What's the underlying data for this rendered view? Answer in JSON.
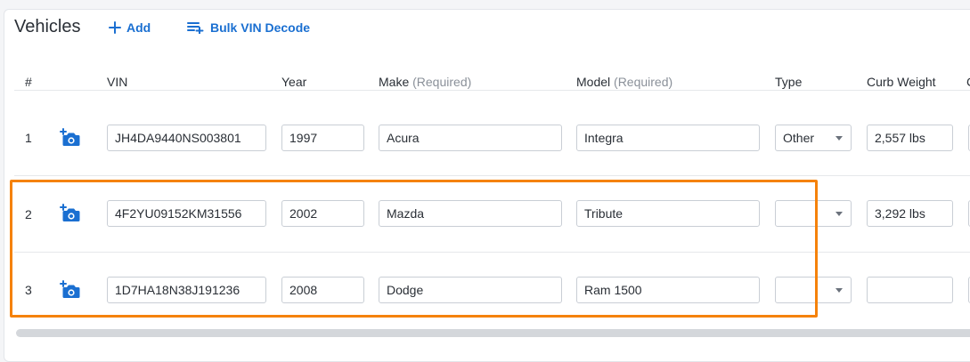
{
  "toolbar": {
    "title": "Vehicles",
    "add_label": "Add",
    "bulk_label": "Bulk VIN Decode"
  },
  "columns": {
    "num": "#",
    "vin": "VIN",
    "year": "Year",
    "make": "Make",
    "make_req": "(Required)",
    "model": "Model",
    "model_req": "(Required)",
    "type": "Type",
    "curb_weight": "Curb Weight",
    "next": "C"
  },
  "rows": [
    {
      "num": "1",
      "vin": "JH4DA9440NS003801",
      "year": "1997",
      "make": "Acura",
      "model": "Integra",
      "type": "Other",
      "curb_weight": "2,557 lbs"
    },
    {
      "num": "2",
      "vin": "4F2YU09152KM31556",
      "year": "2002",
      "make": "Mazda",
      "model": "Tribute",
      "type": "",
      "curb_weight": "3,292 lbs"
    },
    {
      "num": "3",
      "vin": "1D7HA18N38J191236",
      "year": "2008",
      "make": "Dodge",
      "model": "Ram 1500",
      "type": "",
      "curb_weight": ""
    }
  ],
  "colors": {
    "accent": "#1a6fd1",
    "highlight": "#f5820b"
  },
  "icons": {
    "add": "plus-icon",
    "bulk": "list-add-icon",
    "photo": "camera-add-icon",
    "dropdown": "chevron-down-icon"
  }
}
